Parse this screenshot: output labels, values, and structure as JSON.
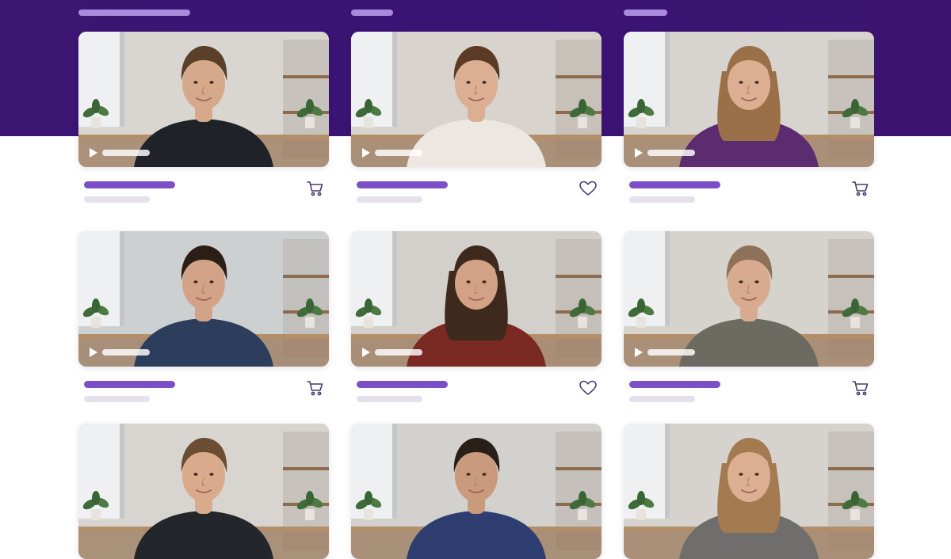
{
  "theme": {
    "accent": "#7b4fc6",
    "hero_band": "#3b1374",
    "placeholder_light": "#e6e0ee",
    "icon_color": "#4a3a6e"
  },
  "header": {
    "placeholder_bars": 3
  },
  "cards": [
    {
      "row": 1,
      "col": 1,
      "action_icon": "cart-icon",
      "has_play_control": true,
      "subject": "man-curly-hair-dark-shirt"
    },
    {
      "row": 1,
      "col": 2,
      "action_icon": "heart-icon",
      "has_play_control": true,
      "subject": "woman-white-blouse"
    },
    {
      "row": 1,
      "col": 3,
      "action_icon": "cart-icon",
      "has_play_control": true,
      "subject": "woman-wavy-hair-purple-top"
    },
    {
      "row": 2,
      "col": 1,
      "action_icon": "cart-icon",
      "has_play_control": true,
      "subject": "man-curly-hair-navy-tee"
    },
    {
      "row": 2,
      "col": 2,
      "action_icon": "heart-icon",
      "has_play_control": true,
      "subject": "woman-long-hair-maroon-top"
    },
    {
      "row": 2,
      "col": 3,
      "action_icon": "cart-icon",
      "has_play_control": true,
      "subject": "woman-grey-shirt"
    },
    {
      "row": 3,
      "col": 1,
      "action_icon": "",
      "has_play_control": false,
      "subject": "man-dark-hoodie"
    },
    {
      "row": 3,
      "col": 2,
      "action_icon": "",
      "has_play_control": false,
      "subject": "man-curly-hair-blue-shirt"
    },
    {
      "row": 3,
      "col": 3,
      "action_icon": "",
      "has_play_control": false,
      "subject": "woman-wavy-hair-grey-top"
    }
  ]
}
